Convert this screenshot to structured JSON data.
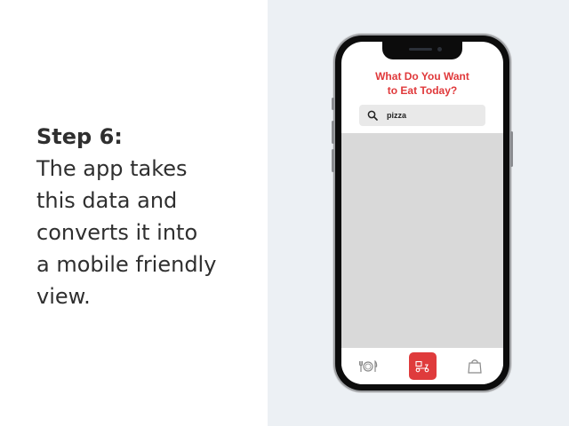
{
  "slide": {
    "step_title": "Step 6:",
    "lines": [
      "The app takes",
      "this data and",
      "converts it into",
      "a mobile friendly",
      "view."
    ]
  },
  "app": {
    "title_line1": "What Do You Want",
    "title_line2": "to Eat Today?",
    "search": {
      "value": "pizza",
      "icon": "search-icon"
    },
    "tabs": [
      {
        "icon": "restaurant-icon",
        "active": false
      },
      {
        "icon": "delivery-scooter-icon",
        "active": true
      },
      {
        "icon": "shopping-bag-icon",
        "active": false
      }
    ]
  },
  "colors": {
    "accent": "#e0393b",
    "background_right": "#ecf0f4",
    "results_area": "#d9d9d9",
    "text": "#2f2f2f"
  }
}
